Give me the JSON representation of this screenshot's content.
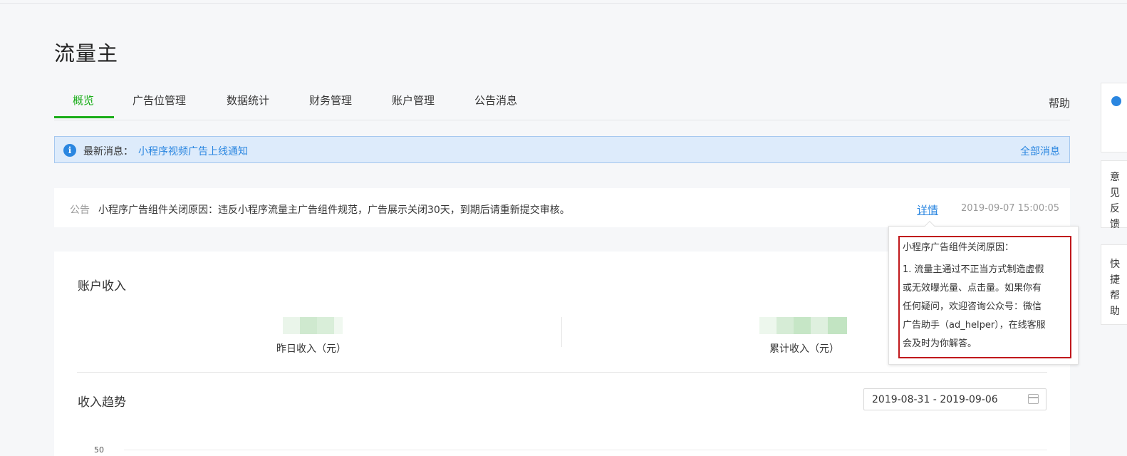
{
  "app": {
    "title": "流量主"
  },
  "tabs": [
    {
      "label": "概览",
      "active": true
    },
    {
      "label": "广告位管理"
    },
    {
      "label": "数据统计"
    },
    {
      "label": "财务管理"
    },
    {
      "label": "账户管理"
    },
    {
      "label": "公告消息"
    }
  ],
  "help_label": "帮助",
  "news": {
    "icon": "info-icon",
    "label": "最新消息：",
    "link": "小程序视频广告上线通知",
    "all_label": "全部消息"
  },
  "notice": {
    "tag": "公告",
    "text": "小程序广告组件关闭原因：违反小程序流量主广告组件规范，广告展示关闭30天，到期后请重新提交审核。",
    "detail_label": "详情",
    "time": "2019-09-07 15:00:05"
  },
  "tooltip": {
    "title": "小程序广告组件关闭原因：",
    "lines": [
      "1. 流量主通过不正当方式制造虚假",
      "或无效曝光量、点击量。如果你有",
      "任何疑问，欢迎咨询公众号：微信",
      "广告助手（ad_helper），在线客服",
      "会及时为你解答。"
    ]
  },
  "account": {
    "title": "账户收入",
    "yesterday_label": "昨日收入（元）",
    "total_label": "累计收入（元）"
  },
  "trend": {
    "title": "收入趋势",
    "date_range": "2019-08-31 - 2019-09-06",
    "y_tick": "50"
  },
  "side_panel": {
    "feedback": [
      "意",
      "见",
      "反",
      "馈"
    ],
    "quick_help": [
      "快",
      "捷",
      "帮",
      "助"
    ]
  },
  "colors": {
    "accent_green": "#1aad19",
    "link_blue": "#2a86e0",
    "highlight_red": "#c0181c"
  }
}
